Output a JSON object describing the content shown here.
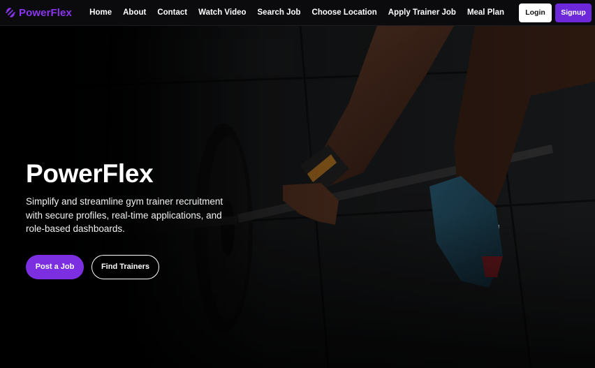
{
  "brand": {
    "name": "PowerFlex",
    "icon": "dumbbell-icon",
    "color": "#8b35f0"
  },
  "nav": {
    "links": [
      {
        "label": "Home"
      },
      {
        "label": "About"
      },
      {
        "label": "Contact"
      },
      {
        "label": "Watch Video"
      },
      {
        "label": "Search Job"
      },
      {
        "label": "Choose Location"
      },
      {
        "label": "Apply Trainer Job"
      },
      {
        "label": "Meal Plan"
      }
    ],
    "login_label": "Login",
    "signup_label": "Signup"
  },
  "hero": {
    "title": "PowerFlex",
    "description": "Simplify and streamline gym trainer recruitment with secure profiles, real-time applications, and role-based dashboards.",
    "primary_button": "Post a Job",
    "secondary_button": "Find Trainers",
    "background": "gym-barbell-photo"
  },
  "colors": {
    "accent": "#7c2fe0",
    "signup": "#6d28d9",
    "navbar": "#0b0b0d"
  }
}
